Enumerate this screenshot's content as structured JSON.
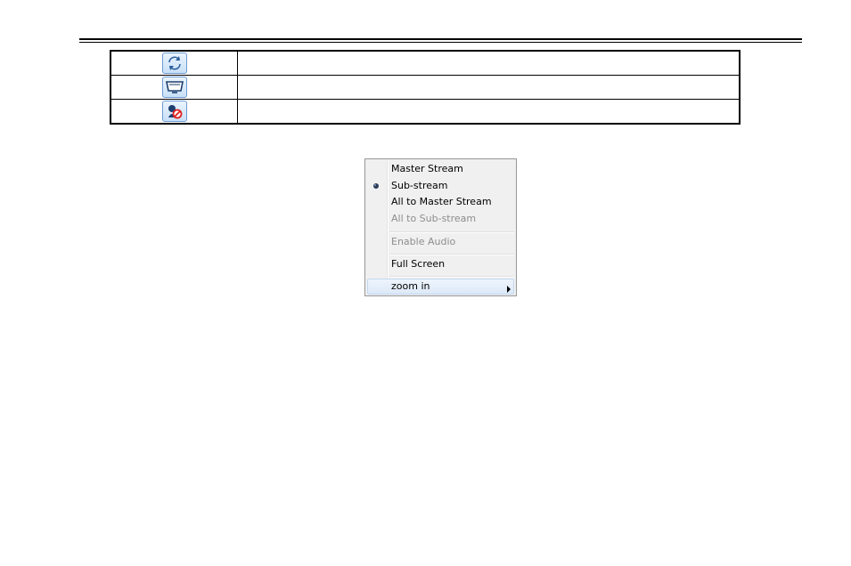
{
  "toolbar_icons": [
    {
      "icon": "refresh-icon",
      "description": ""
    },
    {
      "icon": "fullscreen-monitor-icon",
      "description": ""
    },
    {
      "icon": "mute-audio-icon",
      "description": ""
    }
  ],
  "context_menu": {
    "items": [
      {
        "label": "Master Stream",
        "enabled": true,
        "checked": false
      },
      {
        "label": "Sub-stream",
        "enabled": true,
        "checked": true
      },
      {
        "label": "All to Master Stream",
        "enabled": true,
        "checked": false
      },
      {
        "label": "All to Sub-stream",
        "enabled": false,
        "checked": false
      },
      {
        "label": "Enable Audio",
        "enabled": false,
        "checked": false
      },
      {
        "label": "Full Screen",
        "enabled": true,
        "checked": false
      },
      {
        "label": "zoom in",
        "enabled": true,
        "checked": false,
        "submenu": true,
        "highlighted": true
      }
    ]
  },
  "colors": {
    "menu_background": "#f0f0f0",
    "menu_border": "#979797",
    "disabled_text": "#8d8d8d",
    "button_border": "#6d9bd3",
    "button_fill": "#c9e0f8",
    "icon_blue": "#2a5d9e",
    "icon_red": "#e02020"
  }
}
